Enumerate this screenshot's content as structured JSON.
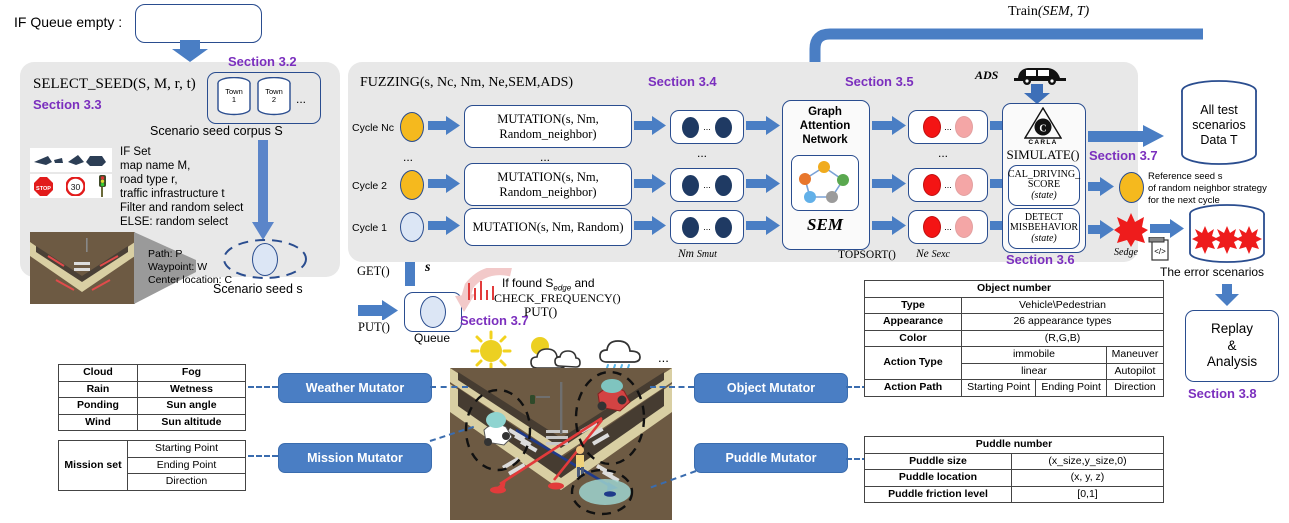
{
  "top": {
    "queue_empty_label": "IF Queue empty :",
    "train_label": "Train",
    "train_args": "(SEM, T)"
  },
  "select_seed": {
    "title": "SELECT_SEED(S, M, r, t)",
    "section": "Section 3.3",
    "corpus_section": "Section 3.2",
    "corpus_caption": "Scenario seed corpus S",
    "towns": [
      "Town 1",
      "Town 2",
      "..."
    ],
    "rules": [
      "IF Set",
      "map name M,",
      "road type r,",
      "traffic infrastructure t",
      "Filter and random select",
      "ELSE: random select"
    ],
    "path_lines": [
      "Path: P",
      "Waypoint: W",
      "Center location: C"
    ],
    "seed_caption": "Scenario seed  s",
    "signs": [
      "STOP",
      "30"
    ]
  },
  "queue": {
    "get_label": "GET()",
    "get_var": "s",
    "put_label": "PUT()",
    "queue_label": "Queue",
    "found_line1": "If found S",
    "found_sub": "edge",
    "found_line1b": " and",
    "found_line2": "CHECK_FREQUENCY()",
    "found_line3": "PUT()",
    "section": "Section 3.7"
  },
  "fuzzing": {
    "title": "FUZZING(s, Nc, Nm, Ne,SEM,ADS)",
    "section": "Section 3.4",
    "cycles": [
      {
        "label": "Cycle Nc",
        "mutation": "MUTATION(s, Nm,\nRandom_neighbor)",
        "color": "#f5b91e"
      },
      {
        "label": "...",
        "mutation": "...",
        "color": ""
      },
      {
        "label": "Cycle 2",
        "mutation": "MUTATION(s, Nm,\nRandom_neighbor)",
        "color": "#f5b91e"
      },
      {
        "label": "Cycle 1",
        "mutation": "MUTATION(s, Nm, Random)",
        "color": "#dce6f5"
      }
    ],
    "mut_caption_n": "Nm",
    "mut_caption_s": "Smut",
    "topsort_label": "TOPSORT()",
    "exc_caption_n": "Ne",
    "exc_caption_s": "Sexc"
  },
  "gat": {
    "section": "Section 3.5",
    "title_lines": [
      "Graph",
      "Attention",
      "Network"
    ],
    "model_name": "SEM",
    "node_colors": [
      "#f0ab1e",
      "#e8762c",
      "#5aa84f",
      "#9b9b9b",
      "#62b0e8"
    ]
  },
  "simulate": {
    "section": "Section 3.6",
    "ads_label": "ADS",
    "carla_label": "CARLA",
    "simulate_label": "SIMULATE()",
    "score_lines": [
      "CAL_DRIVING_",
      "SCORE",
      "(state)"
    ],
    "detect_lines": [
      "DETECT",
      "MISBEHAVIOR",
      "(state)"
    ]
  },
  "outputs": {
    "section_37": "Section 3.7",
    "all_test_lines": [
      "All test",
      "scenarios",
      "Data T"
    ],
    "reference_lines": [
      "Reference seed s",
      "of random neighbor strategy",
      "for the next cycle"
    ],
    "s_edge_label": "Sedge",
    "error_caption": "The error scenarios",
    "replay_lines": [
      "Replay",
      "&",
      "Analysis"
    ],
    "section_38": "Section 3.8"
  },
  "mutators": {
    "weather": "Weather Mutator",
    "mission": "Mission Mutator",
    "object": "Object Mutator",
    "puddle": "Puddle Mutator"
  },
  "weather_table": {
    "rows": [
      [
        "Cloud",
        "Fog"
      ],
      [
        "Rain",
        "Wetness"
      ],
      [
        "Ponding",
        "Sun angle"
      ],
      [
        "Wind",
        "Sun altitude"
      ]
    ]
  },
  "mission_table": {
    "header": "Mission set",
    "rows": [
      "Starting Point",
      "Ending Point",
      "Direction"
    ]
  },
  "object_table": {
    "title": "Object number",
    "rows": [
      {
        "label": "Type",
        "value": "Vehicle\\Pedestrian"
      },
      {
        "label": "Appearance",
        "value": "26 appearance types"
      },
      {
        "label": "Color",
        "value": "(R,G,B)"
      }
    ],
    "action_type_label": "Action Type",
    "action_type_cells": [
      [
        "immobile",
        "Maneuver"
      ],
      [
        "linear",
        "Autopilot"
      ]
    ],
    "action_path_label": "Action Path",
    "action_path_cells": [
      "Starting Point",
      "Ending Point",
      "Direction"
    ]
  },
  "puddle_table": {
    "title": "Puddle number",
    "rows": [
      {
        "label": "Puddle size",
        "value": "(x_size,y_size,0)"
      },
      {
        "label": "Puddle location",
        "value": "(x, y, z)"
      },
      {
        "label": "Puddle friction level",
        "value": "[0,1]"
      }
    ]
  },
  "colors": {
    "arrow_blue": "#4a7ec4",
    "outline_blue": "#2a4d8f",
    "section_purple": "#7b2fbe",
    "panel_gray": "#e8e8e8",
    "yellow_seed": "#f5b91e",
    "red_exc": "#f41414"
  }
}
